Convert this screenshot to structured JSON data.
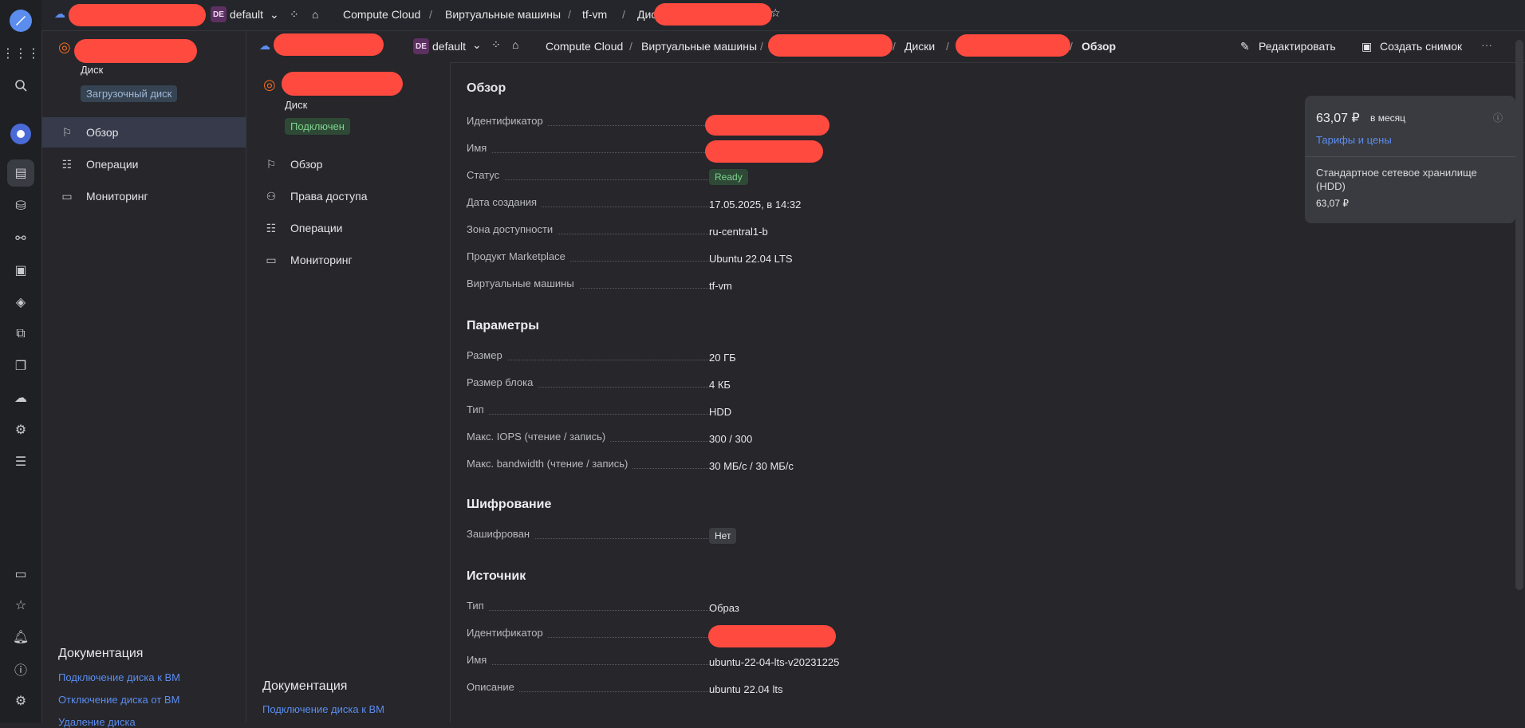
{
  "colors": {
    "accent": "#5b8def",
    "status_ok": "#7fd28e",
    "redaction": "#ff4a3f",
    "brand_orange": "#f26b1d"
  },
  "topbar": {
    "cloud_icon": "cloud-icon",
    "folder_badge": "DE",
    "folder": "default",
    "crumbs": [
      "Compute Cloud",
      "Виртуальные машины",
      "tf-vm",
      "Диски"
    ]
  },
  "subbar": {
    "folder_badge": "DE",
    "folder": "default",
    "crumbs": [
      "Compute Cloud",
      "Виртуальные машины",
      "Диски"
    ],
    "current": "Обзор",
    "edit": "Редактировать",
    "snapshot": "Создать снимок",
    "more": "···"
  },
  "panel1": {
    "subtitle": "Диск",
    "tag": "Загрузочный диск",
    "nav": [
      "Обзор",
      "Операции",
      "Мониторинг"
    ],
    "docs_title": "Документация",
    "docs": [
      "Подключение диска к ВМ",
      "Отключение диска от ВМ",
      "Удаление диска"
    ]
  },
  "panel2": {
    "subtitle": "Диск",
    "tag": "Подключен",
    "nav": [
      "Обзор",
      "Права доступа",
      "Операции",
      "Мониторинг"
    ],
    "docs_title": "Документация",
    "docs": [
      "Подключение диска к ВМ"
    ]
  },
  "main": {
    "title": "Обзор",
    "overview": {
      "id_label": "Идентификатор",
      "name_label": "Имя",
      "status_label": "Статус",
      "status": "Ready",
      "created_label": "Дата создания",
      "created": "17.05.2025, в 14:32",
      "zone_label": "Зона доступности",
      "zone": "ru-central1-b",
      "product_label": "Продукт Marketplace",
      "product": "Ubuntu 22.04 LTS",
      "vm_label": "Виртуальные машины",
      "vm": "tf-vm"
    },
    "params": {
      "title": "Параметры",
      "size_label": "Размер",
      "size": "20 ГБ",
      "block_label": "Размер блока",
      "block": "4 КБ",
      "type_label": "Тип",
      "type": "HDD",
      "iops_label": "Макс. IOPS (чтение / запись)",
      "iops": "300 / 300",
      "bw_label": "Макс. bandwidth (чтение / запись)",
      "bw": "30 МБ/с / 30 МБ/с"
    },
    "encryption": {
      "title": "Шифрование",
      "enc_label": "Зашифрован",
      "enc": "Нет"
    },
    "source": {
      "title": "Источник",
      "type_label": "Тип",
      "type": "Образ",
      "id_label": "Идентификатор",
      "name_label": "Имя",
      "name": "ubuntu-22-04-lts-v20231225",
      "desc_label": "Описание",
      "desc": "ubuntu 22.04 lts"
    }
  },
  "price": {
    "amount": "63,07 ₽",
    "period": "в месяц",
    "link": "Тарифы и цены",
    "item": "Стандартное сетевое хранилище (HDD)",
    "item_price": "63,07 ₽"
  }
}
